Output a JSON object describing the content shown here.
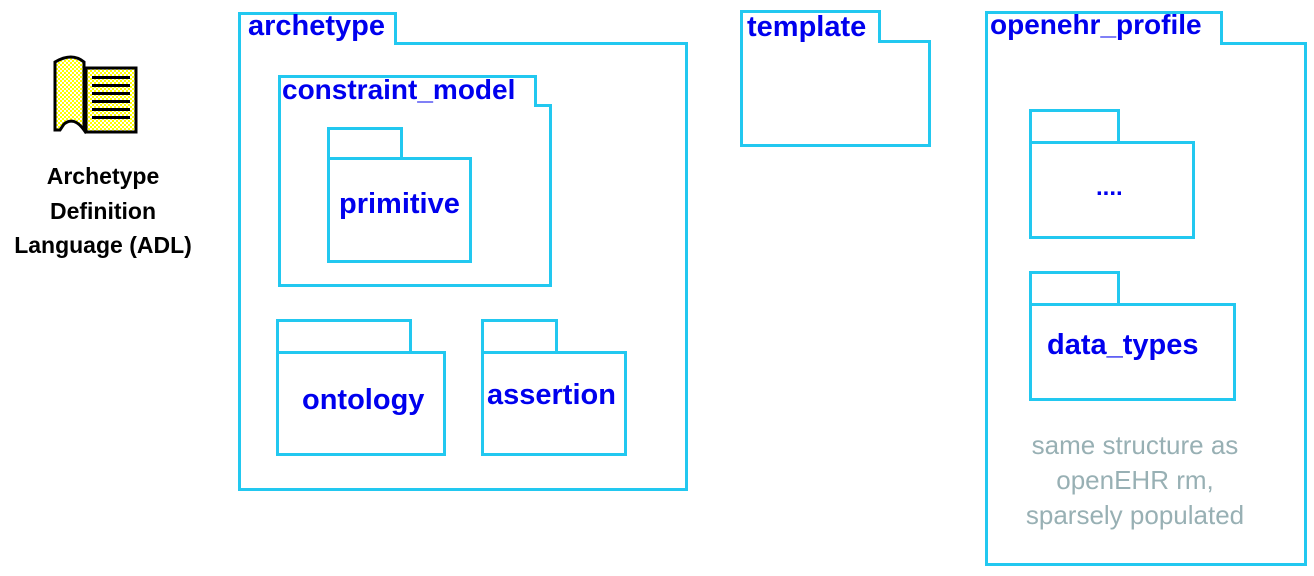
{
  "legend": {
    "icon": "book-icon",
    "label_lines": [
      "Archetype",
      "Definition",
      "Language (ADL)"
    ]
  },
  "packages": {
    "archetype": "archetype",
    "constraint_model": "constraint_model",
    "primitive": "primitive",
    "ontology": "ontology",
    "assertion": "assertion",
    "template": "template",
    "openehr_profile": "openehr_profile",
    "ellipsis": "....",
    "data_types": "data_types"
  },
  "note_lines": [
    "same structure as",
    "openEHR rm,",
    "sparsely populated"
  ],
  "colors": {
    "border": "#22c8f0",
    "text": "#0000ee",
    "note": "#98b0b4"
  }
}
